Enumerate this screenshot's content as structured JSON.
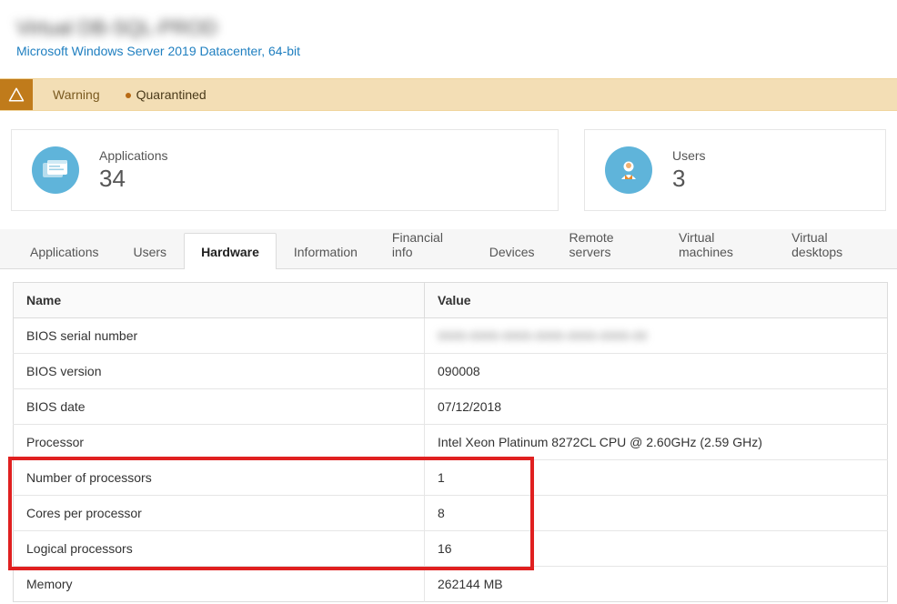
{
  "header": {
    "title": "Virtual DB-SQL-PROD",
    "subtitle": "Microsoft Windows Server 2019 Datacenter, 64-bit"
  },
  "warning": {
    "label": "Warning",
    "status": "Quarantined"
  },
  "cards": {
    "applications": {
      "label": "Applications",
      "value": "34"
    },
    "users": {
      "label": "Users",
      "value": "3"
    }
  },
  "tabs": [
    "Applications",
    "Users",
    "Hardware",
    "Information",
    "Financial info",
    "Devices",
    "Remote servers",
    "Virtual machines",
    "Virtual desktops"
  ],
  "active_tab_index": 2,
  "table": {
    "headers": {
      "name": "Name",
      "value": "Value"
    },
    "rows": [
      {
        "name": "BIOS serial number",
        "value": "0000-0000-0000-0000-0000-0000-00",
        "blur": true
      },
      {
        "name": "BIOS version",
        "value": "090008"
      },
      {
        "name": "BIOS date",
        "value": "07/12/2018"
      },
      {
        "name": "Processor",
        "value": "Intel Xeon Platinum 8272CL CPU @ 2.60GHz (2.59 GHz)"
      },
      {
        "name": "Number of processors",
        "value": "1"
      },
      {
        "name": "Cores per processor",
        "value": "8"
      },
      {
        "name": "Logical processors",
        "value": "16"
      },
      {
        "name": "Memory",
        "value": "262144 MB"
      }
    ]
  }
}
